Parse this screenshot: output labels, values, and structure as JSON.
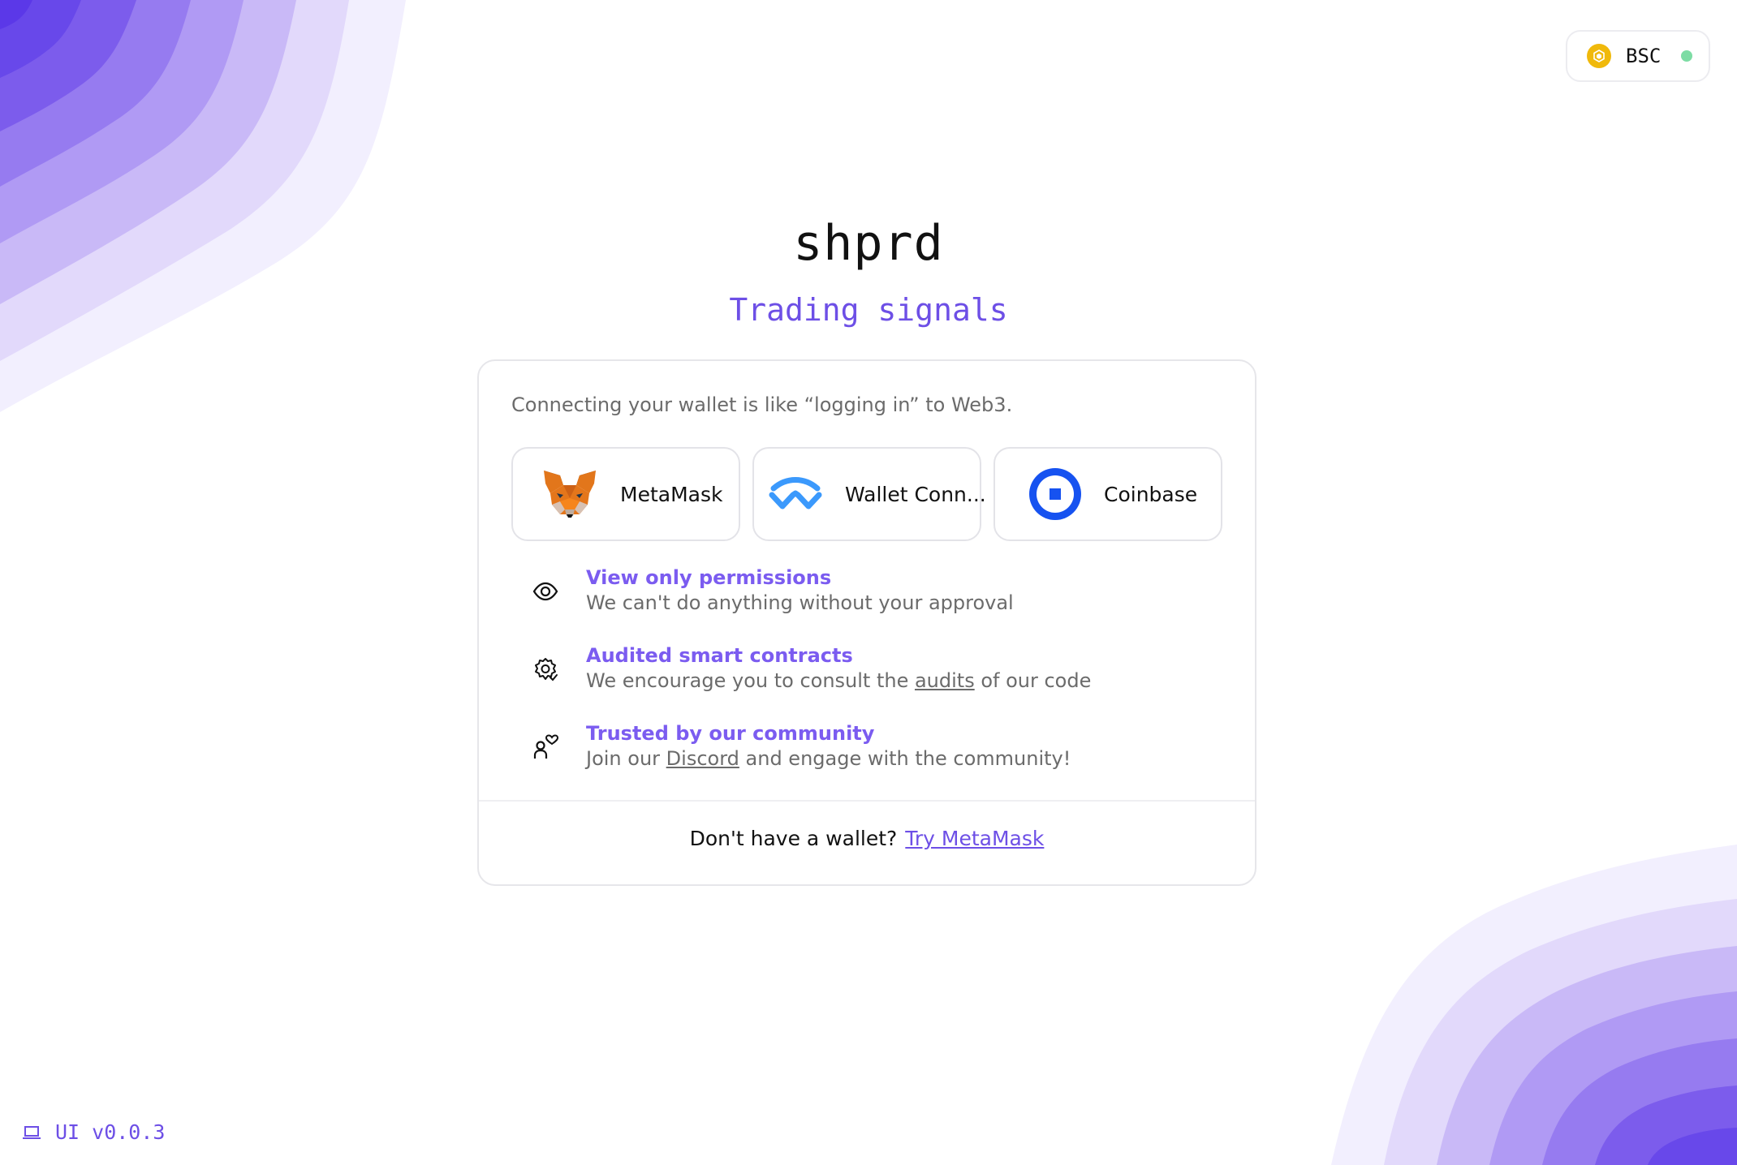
{
  "network": {
    "label": "BSC",
    "icon": "bnb-icon",
    "status_color": "#7ddca4"
  },
  "brand": {
    "name": "shprd",
    "tagline": "Trading signals"
  },
  "card": {
    "intro": "Connecting your wallet is like “logging in” to Web3.",
    "wallets": [
      {
        "label": "MetaMask",
        "icon": "metamask-fox-icon"
      },
      {
        "label": "Wallet Conn...",
        "icon": "walletconnect-icon"
      },
      {
        "label": "Coinbase",
        "icon": "coinbase-icon"
      }
    ],
    "features": [
      {
        "icon": "eye-icon",
        "title": "View only permissions",
        "desc": "We can't do anything without your approval"
      },
      {
        "icon": "gear-check-icon",
        "title": "Audited smart contracts",
        "desc_before": "We encourage you to consult the ",
        "link": "audits",
        "desc_after": " of our code"
      },
      {
        "icon": "community-heart-icon",
        "title": "Trusted by our community",
        "desc_before": "Join our ",
        "link": "Discord",
        "desc_after": " and engage with the community!"
      }
    ],
    "footer": {
      "question": "Don't have a wallet?",
      "link": "Try MetaMask"
    }
  },
  "version": {
    "label": "UI v0.0.3",
    "icon": "laptop-icon"
  },
  "colors": {
    "accent": "#6d4fe6",
    "feature_title": "#7b5cf0",
    "muted_text": "#6b6b6b"
  }
}
